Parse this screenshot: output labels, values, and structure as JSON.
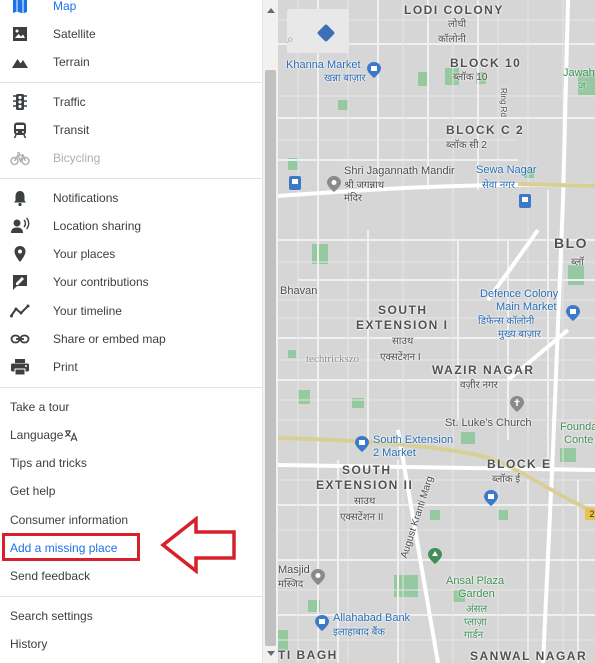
{
  "menu": {
    "map_types": [
      {
        "label": "Map",
        "icon": "map-icon"
      },
      {
        "label": "Satellite",
        "icon": "satellite-icon"
      },
      {
        "label": "Terrain",
        "icon": "terrain-icon"
      }
    ],
    "layers": [
      {
        "label": "Traffic",
        "icon": "traffic-light-icon"
      },
      {
        "label": "Transit",
        "icon": "transit-icon"
      },
      {
        "label": "Bicycling",
        "icon": "bicycle-icon",
        "disabled": true
      }
    ],
    "personal": [
      {
        "label": "Notifications",
        "icon": "bell-icon"
      },
      {
        "label": "Location sharing",
        "icon": "location-sharing-icon"
      },
      {
        "label": "Your places",
        "icon": "place-pin-icon"
      },
      {
        "label": "Your contributions",
        "icon": "contributions-icon"
      },
      {
        "label": "Your timeline",
        "icon": "timeline-icon"
      },
      {
        "label": "Share or embed map",
        "icon": "link-icon"
      },
      {
        "label": "Print",
        "icon": "printer-icon"
      }
    ],
    "help": [
      {
        "label": "Take a tour"
      },
      {
        "label": "Language"
      },
      {
        "label": "Tips and tricks"
      },
      {
        "label": "Get help"
      },
      {
        "label": "Consumer information"
      },
      {
        "label": "Add a missing place"
      },
      {
        "label": "Send feedback"
      }
    ],
    "footer": [
      {
        "label": "Search settings"
      },
      {
        "label": "History"
      }
    ],
    "language_icon": "translate-icon"
  },
  "map": {
    "labels": {
      "lodi_colony_en": "LODI COLONY",
      "lodi_colony_hi": "लोधी",
      "lodi_colony_hi2": "कॉलोनी",
      "khanna_market_en": "Khanna Market",
      "khanna_market_hi": "खन्ना बाज़ार",
      "block10_en": "BLOCK 10",
      "block10_hi": "ब्लॉक 10",
      "jawa_en": "Jawah",
      "jawa_hi": "ज",
      "block_c2_en": "BLOCK C 2",
      "block_c2_hi": "ब्लॉक सी 2",
      "jagannath_en": "Shri Jagannath Mandir",
      "jagannath_hi": "श्री जगन्नाथ",
      "jagannath_hi2": "मंदिर",
      "sewa_nagar_en": "Sewa Nagar",
      "sewa_nagar_hi": "सेवा नगर",
      "blo": "BLO",
      "blo_hi": "ब्लॉ",
      "bhavan": "Bhavan",
      "south_ext1_en": "SOUTH",
      "south_ext1_en2": "EXTENSION I",
      "south_ext1_hi": "साउथ",
      "south_ext1_hi2": "एक्सटेंशन I",
      "defence_en": "Defence Colony",
      "defence_en2": "Main Market",
      "defence_hi": "डिफेन्स कॉलोनी",
      "defence_hi2": "मुख्य बाज़ार",
      "watermark": "techtrickszo",
      "wazir_nagar_en": "WAZIR NAGAR",
      "wazir_nagar_hi": "वज़ीर नगर",
      "st_lukes": "St. Luke's Church",
      "foundation": "Foundatio",
      "centre": "Conte",
      "south_ext_market_en": "South Extension",
      "south_ext_market_en2": "2 Market",
      "block_e_en": "BLOCK E",
      "block_e_hi": "ब्लॉक ई",
      "south_ext2_en": "SOUTH",
      "south_ext2_en2": "EXTENSION II",
      "south_ext2_hi": "साउथ",
      "south_ext2_hi2": "एक्सटेंशन II",
      "august_kranti": "August Kranti Marg",
      "ansal_en": "Ansal Plaza",
      "ansal_en2": "Garden",
      "ansal_hi": "अंसल",
      "ansal_hi2": "प्लाज़ा",
      "ansal_hi3": "गार्डन",
      "masjid_en": "Masjid",
      "masjid_hi": "मस्जिद",
      "allahabad_en": "Allahabad Bank",
      "allahabad_hi": "इलाहाबाद बैंक",
      "ti_bagh": "TI BAGH",
      "sanwal_nagar": "SANWAL NAGAR",
      "road_sign": "2",
      "road_label": "Ring Rd"
    }
  },
  "colors": {
    "map_bg": "#d6d6d6",
    "road": "#ffffff",
    "highway": "#d8cf97",
    "park": "#8fc89b",
    "link": "#1a73e8",
    "annotation": "#d8202a"
  }
}
